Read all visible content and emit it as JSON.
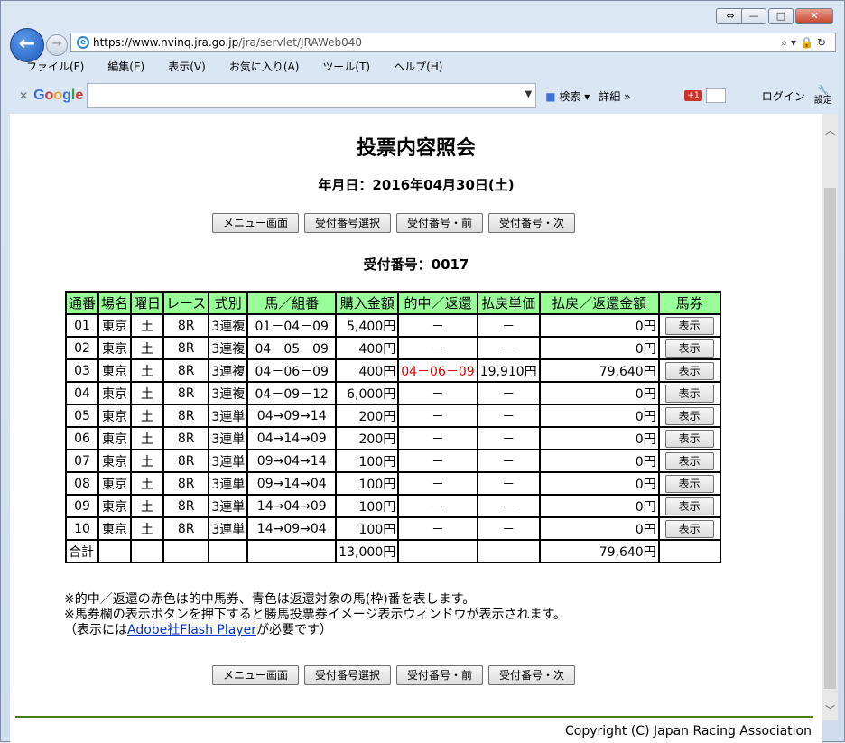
{
  "browser": {
    "url_host": "https://www.nvinq.jra.go.jp",
    "url_path": "/jra/servlet/JRAWeb040",
    "menu": [
      "ファイル(F)",
      "編集(E)",
      "表示(V)",
      "お気に入り(A)",
      "ツール(T)",
      "ヘルプ(H)"
    ],
    "google_logo": "Google",
    "search_btn": "検索",
    "detail": "詳細 »",
    "gplus": "+1",
    "login": "ログイン",
    "settings": "設定"
  },
  "page": {
    "title": "投票内容照会",
    "date": "年月日：2016年04月30日(土)",
    "buttons": [
      "メニュー画面",
      "受付番号選択",
      "受付番号・前",
      "受付番号・次"
    ],
    "receipt": "受付番号：0017",
    "columns": [
      "通番",
      "場名",
      "曜日",
      "レース",
      "式別",
      "馬／組番",
      "購入金額",
      "的中／返還",
      "払戻単価",
      "払戻／返還金額",
      "馬券"
    ],
    "show_label": "表示",
    "rows": [
      {
        "no": "01",
        "place": "東京",
        "day": "土",
        "race": "8R",
        "type": "3連複",
        "combo": "01－04－09",
        "amount": "5,400円",
        "hit": "－",
        "unit": "－",
        "pay": "0円",
        "hit_red": false
      },
      {
        "no": "02",
        "place": "東京",
        "day": "土",
        "race": "8R",
        "type": "3連複",
        "combo": "04－05－09",
        "amount": "400円",
        "hit": "－",
        "unit": "－",
        "pay": "0円",
        "hit_red": false
      },
      {
        "no": "03",
        "place": "東京",
        "day": "土",
        "race": "8R",
        "type": "3連複",
        "combo": "04－06－09",
        "amount": "400円",
        "hit": "04－06－09",
        "unit": "19,910円",
        "pay": "79,640円",
        "hit_red": true
      },
      {
        "no": "04",
        "place": "東京",
        "day": "土",
        "race": "8R",
        "type": "3連複",
        "combo": "04－09－12",
        "amount": "6,000円",
        "hit": "－",
        "unit": "－",
        "pay": "0円",
        "hit_red": false
      },
      {
        "no": "05",
        "place": "東京",
        "day": "土",
        "race": "8R",
        "type": "3連単",
        "combo": "04→09→14",
        "amount": "200円",
        "hit": "－",
        "unit": "－",
        "pay": "0円",
        "hit_red": false
      },
      {
        "no": "06",
        "place": "東京",
        "day": "土",
        "race": "8R",
        "type": "3連単",
        "combo": "04→14→09",
        "amount": "200円",
        "hit": "－",
        "unit": "－",
        "pay": "0円",
        "hit_red": false
      },
      {
        "no": "07",
        "place": "東京",
        "day": "土",
        "race": "8R",
        "type": "3連単",
        "combo": "09→04→14",
        "amount": "100円",
        "hit": "－",
        "unit": "－",
        "pay": "0円",
        "hit_red": false
      },
      {
        "no": "08",
        "place": "東京",
        "day": "土",
        "race": "8R",
        "type": "3連単",
        "combo": "09→14→04",
        "amount": "100円",
        "hit": "－",
        "unit": "－",
        "pay": "0円",
        "hit_red": false
      },
      {
        "no": "09",
        "place": "東京",
        "day": "土",
        "race": "8R",
        "type": "3連単",
        "combo": "14→04→09",
        "amount": "100円",
        "hit": "－",
        "unit": "－",
        "pay": "0円",
        "hit_red": false
      },
      {
        "no": "10",
        "place": "東京",
        "day": "土",
        "race": "8R",
        "type": "3連単",
        "combo": "14→09→04",
        "amount": "100円",
        "hit": "－",
        "unit": "－",
        "pay": "0円",
        "hit_red": false
      }
    ],
    "total_label": "合計",
    "total_amount": "13,000円",
    "total_pay": "79,640円",
    "note1": "※的中／返還の赤色は的中馬券、青色は返還対象の馬(枠)番を表します。",
    "note2": "※馬券欄の表示ボタンを押下すると勝馬投票券イメージ表示ウィンドウが表示されます。",
    "note3_pre": "（表示には",
    "note3_link": "Adobe社Flash Player",
    "note3_post": "が必要です）",
    "copyright": "Copyright (C) Japan Racing Association"
  },
  "colors": {
    "header_bg": "#99ff99",
    "hit_red": "#e00000",
    "link": "#0033cc",
    "rule": "#4b7a1b"
  }
}
